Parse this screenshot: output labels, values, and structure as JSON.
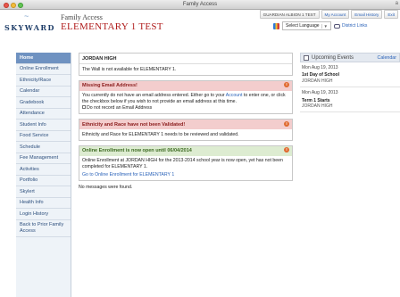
{
  "window": {
    "title": "Family Access",
    "right_glyph": "a"
  },
  "header": {
    "logo_text": "SKYWARD",
    "logo_mark": "~",
    "app_name": "Family Access",
    "school_name": "ELEMENTARY 1 TEST",
    "user_label": "GUARDIAN ALBION 1 TEST",
    "my_account": "My Account",
    "email_history": "Email History",
    "exit": "Exit",
    "select_language": "Select Language",
    "district_links": "District Links"
  },
  "nav": {
    "items": [
      {
        "label": "Home",
        "active": true
      },
      {
        "label": "Online Enrollment"
      },
      {
        "label": "Ethnicity/Race"
      },
      {
        "label": "Calendar"
      },
      {
        "label": "Gradebook"
      },
      {
        "label": "Attendance"
      },
      {
        "label": "Student Info"
      },
      {
        "label": "Food Service"
      },
      {
        "label": "Schedule"
      },
      {
        "label": "Fee Management"
      },
      {
        "label": "Activities"
      },
      {
        "label": "Portfolio"
      },
      {
        "label": "Skylert"
      },
      {
        "label": "Health Info"
      },
      {
        "label": "Login History"
      },
      {
        "label": "Back to Prior Family Access"
      }
    ]
  },
  "main": {
    "wall": {
      "head": "JORDAN HIGH",
      "body": "The Wall is not available for ELEMENTARY 1."
    },
    "email": {
      "head": "Missing Email Address!",
      "text1": "You currently do not have an email address entered. Either go to your ",
      "link": "Account",
      "text2": " to enter one, or click the checkbox below if you wish to not provide an email address at this time.",
      "checkbox_label": "Do not record an Email Address"
    },
    "ethnicity": {
      "head": "Ethnicity and Race have not been Validated!",
      "body": "Ethnicity and Race for ELEMENTARY 1 needs to be reviewed and validated."
    },
    "enrollment": {
      "head": "Online Enrollment is now open until 06/04/2014",
      "body": "Online Enrollment at JORDAN HIGH for the 2013-2014 school year is now open, yet has not been completed for ELEMENTARY 1.",
      "link": "Go to Online Enrollment for ELEMENTARY 1"
    },
    "no_messages": "No messages were found."
  },
  "events": {
    "head": "Upcoming Events",
    "calendar_link": "Calendar",
    "items": [
      {
        "date": "Mon Aug 19, 2013",
        "title": "1st Day of School",
        "school": "JORDAN HIGH"
      },
      {
        "date": "Mon Aug 19, 2013",
        "title": "Term 1 Starts",
        "school": "JORDAN HIGH"
      }
    ]
  },
  "colors": {
    "nav_active": "#6f92c1",
    "school_name": "#b01c1c",
    "alert_red": "#f3cdcd",
    "notice_green": "#ddecd1",
    "link": "#2a62b8"
  }
}
